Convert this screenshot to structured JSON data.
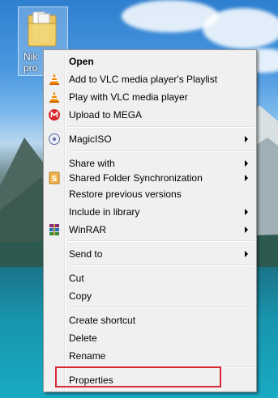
{
  "desktop": {
    "icon_label_line1": "Nik",
    "icon_label_line2": "pro"
  },
  "menu": {
    "items": [
      {
        "label": "Open",
        "icon": "none"
      },
      {
        "label": "Add to VLC media player's Playlist",
        "icon": "vlc-cone-icon"
      },
      {
        "label": "Play with VLC media player",
        "icon": "vlc-cone-icon"
      },
      {
        "label": "Upload to MEGA",
        "icon": "mega-icon"
      },
      {
        "label": "MagicISO",
        "icon": "magiciso-icon"
      },
      {
        "label": "Share with",
        "icon": "none"
      },
      {
        "label": "Shared Folder Synchronization",
        "icon": "sync-icon"
      },
      {
        "label": "Restore previous versions",
        "icon": "none"
      },
      {
        "label": "Include in library",
        "icon": "none"
      },
      {
        "label": "WinRAR",
        "icon": "winrar-icon"
      },
      {
        "label": "Send to",
        "icon": "none"
      },
      {
        "label": "Cut",
        "icon": "none"
      },
      {
        "label": "Copy",
        "icon": "none"
      },
      {
        "label": "Create shortcut",
        "icon": "none"
      },
      {
        "label": "Delete",
        "icon": "none"
      },
      {
        "label": "Rename",
        "icon": "none"
      },
      {
        "label": "Properties",
        "icon": "none"
      }
    ]
  },
  "colors": {
    "highlight_box": "#d62a36",
    "menu_background": "#f0f0f0",
    "vlc_orange": "#f08a00",
    "mega_red": "#d9272e"
  }
}
